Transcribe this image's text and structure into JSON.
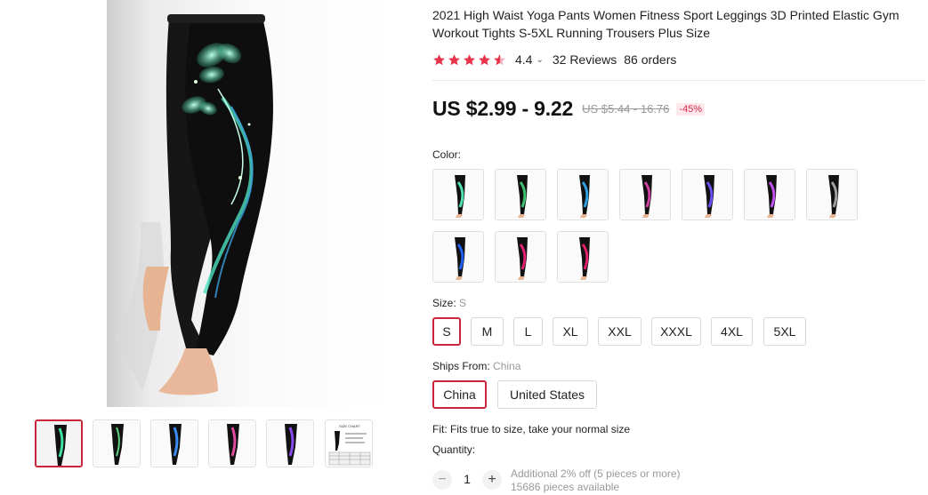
{
  "product": {
    "title": "2021 High Waist Yoga Pants Women Fitness Sport Leggings 3D Printed Elastic Gym Workout Tights S-5XL Running Trousers Plus Size",
    "rating": "4.4",
    "rating_stars": 4.5,
    "reviews": "32 Reviews",
    "orders": "86 orders"
  },
  "price": {
    "current": "US $2.99 - 9.22",
    "original": "US $5.44 - 16.76",
    "discount": "-45%"
  },
  "gallery": {
    "thumbnails": [
      {
        "name": "green butterfly leggings",
        "accent": "#3fe0a0"
      },
      {
        "name": "green swirl leggings",
        "accent": "#5fd080"
      },
      {
        "name": "blue butterfly leggings",
        "accent": "#3a8cf0"
      },
      {
        "name": "pink butterfly leggings",
        "accent": "#e04aa0"
      },
      {
        "name": "purple butterfly leggings",
        "accent": "#8a4af0"
      },
      {
        "name": "size chart",
        "accent": "#333333"
      }
    ],
    "thumb_size_chart_text": "SIZE CHART"
  },
  "color": {
    "label": "Color:",
    "swatches": [
      {
        "accent": "#4fe0b0"
      },
      {
        "accent": "#3fc070"
      },
      {
        "accent": "#2fa0e0"
      },
      {
        "accent": "#d040a0"
      },
      {
        "accent": "#6a50f0"
      },
      {
        "accent": "#c050f0"
      },
      {
        "accent": "#a0a0a0"
      },
      {
        "accent": "#2060f0"
      },
      {
        "accent": "#e02070"
      },
      {
        "accent": "#e0206a"
      }
    ]
  },
  "size": {
    "label": "Size:",
    "selected": "S",
    "options": [
      "S",
      "M",
      "L",
      "XL",
      "XXL",
      "XXXL",
      "4XL",
      "5XL"
    ]
  },
  "ships": {
    "label": "Ships From:",
    "selected": "China",
    "options": [
      "China",
      "United States"
    ]
  },
  "fit": "Fit: Fits true to size, take your normal size",
  "quantity": {
    "label": "Quantity:",
    "value": "1",
    "minus": "−",
    "plus": "+",
    "note_discount": "Additional 2% off (5 pieces or more)",
    "note_available": "15686 pieces available"
  },
  "colors": {
    "accent_red": "#c9253b",
    "star": "#e8334c",
    "discount_bg": "#fde8ec"
  }
}
